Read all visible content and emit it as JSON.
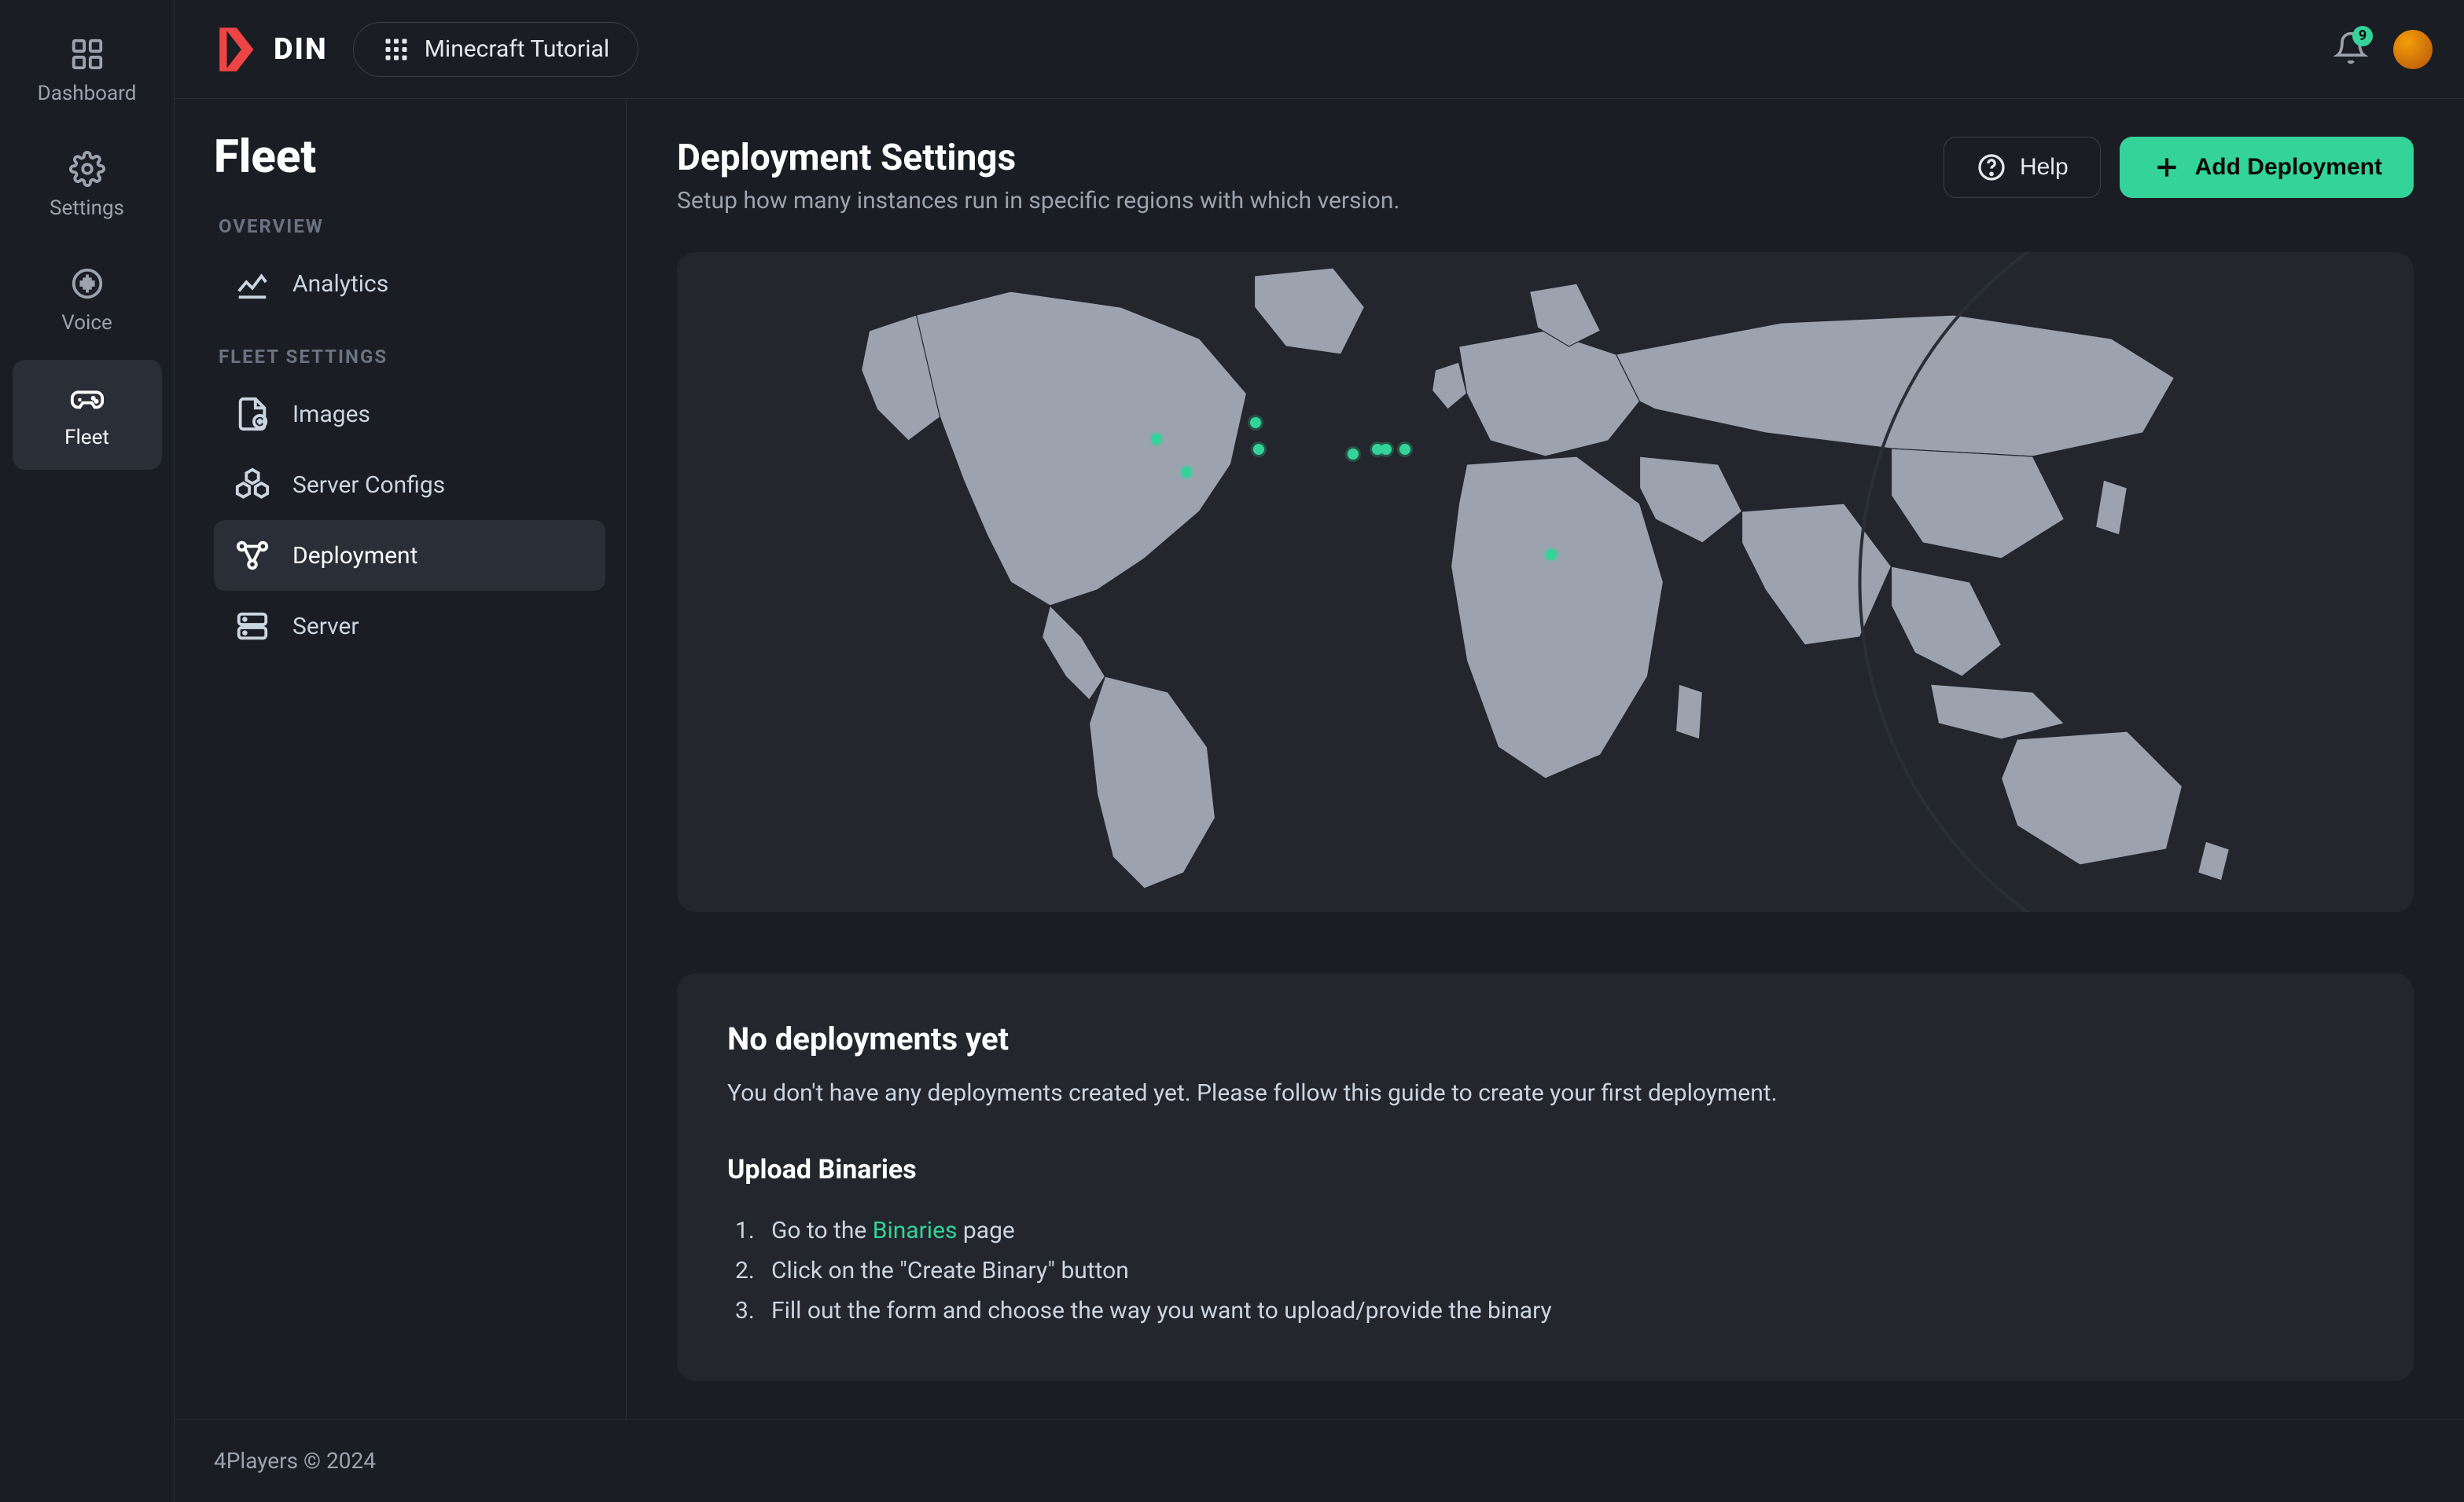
{
  "rail": {
    "dashboard": "Dashboard",
    "settings": "Settings",
    "voice": "Voice",
    "fleet": "Fleet"
  },
  "topbar": {
    "brand": "DIN",
    "app_name": "Minecraft Tutorial",
    "notification_count": "9"
  },
  "sidebar": {
    "title": "Fleet",
    "section_overview": "OVERVIEW",
    "analytics": "Analytics",
    "section_settings": "FLEET SETTINGS",
    "images": "Images",
    "server_configs": "Server Configs",
    "deployment": "Deployment",
    "server": "Server"
  },
  "header": {
    "title": "Deployment Settings",
    "subtitle": "Setup how many instances run in specific regions with which version.",
    "help": "Help",
    "add": "Add Deployment"
  },
  "guide": {
    "empty_title": "No deployments yet",
    "empty_text": "You don't have any deployments created yet. Please follow this guide to create your first deployment.",
    "upload_title": "Upload Binaries",
    "step1_a": "Go to the ",
    "step1_link": "Binaries",
    "step1_b": " page",
    "step2": "Click on the \"Create Binary\" button",
    "step3": "Fill out the form and choose the way you want to upload/provide the binary"
  },
  "footer": "4Players © 2024"
}
